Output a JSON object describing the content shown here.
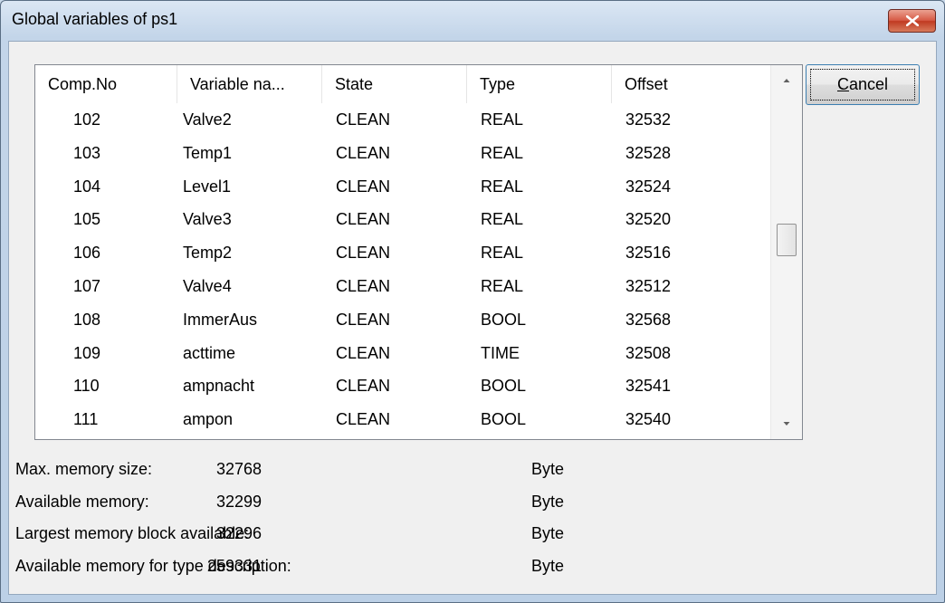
{
  "window": {
    "title": "Global variables of ps1"
  },
  "list": {
    "columns": [
      "Comp.No",
      "Variable na...",
      "State",
      "Type",
      "Offset"
    ],
    "rows": [
      [
        "102",
        "Valve2",
        "CLEAN",
        "REAL",
        "32532"
      ],
      [
        "103",
        "Temp1",
        "CLEAN",
        "REAL",
        "32528"
      ],
      [
        "104",
        "Level1",
        "CLEAN",
        "REAL",
        "32524"
      ],
      [
        "105",
        "Valve3",
        "CLEAN",
        "REAL",
        "32520"
      ],
      [
        "106",
        "Temp2",
        "CLEAN",
        "REAL",
        "32516"
      ],
      [
        "107",
        "Valve4",
        "CLEAN",
        "REAL",
        "32512"
      ],
      [
        "108",
        "ImmerAus",
        "CLEAN",
        "BOOL",
        "32568"
      ],
      [
        "109",
        "acttime",
        "CLEAN",
        "TIME",
        "32508"
      ],
      [
        "110",
        "ampnacht",
        "CLEAN",
        "BOOL",
        "32541"
      ],
      [
        "111",
        "ampon",
        "CLEAN",
        "BOOL",
        "32540"
      ]
    ]
  },
  "buttons": {
    "cancel_mnemonic": "C",
    "cancel_rest": "ancel"
  },
  "memory": {
    "unit": "Byte",
    "rows": [
      {
        "label": "Max. memory size:",
        "value": "32768"
      },
      {
        "label": "Available memory:",
        "value": "32299"
      },
      {
        "label": "Largest memory block available:",
        "value": "32296"
      },
      {
        "label": "Available memory for type description:",
        "value": "259331"
      }
    ]
  },
  "colors": {
    "close_button": "#c7432b",
    "focus_border": "#3c7fb1"
  }
}
